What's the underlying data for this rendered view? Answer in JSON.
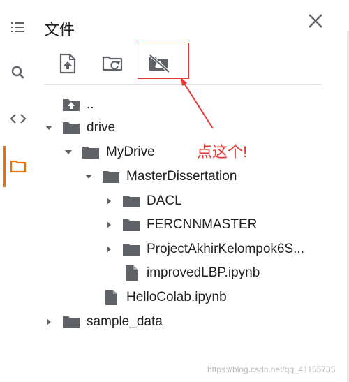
{
  "sidebar": {
    "items": [
      {
        "name": "table-of-contents-icon"
      },
      {
        "name": "search-icon"
      },
      {
        "name": "code-snippets-icon"
      },
      {
        "name": "files-folder-icon",
        "active": true
      }
    ],
    "accent_color": "#e8710a"
  },
  "panel": {
    "title": "文件",
    "close_icon": "close-icon",
    "toolbar": [
      {
        "name": "upload-file-button",
        "icon": "upload-file-icon"
      },
      {
        "name": "refresh-folder-button",
        "icon": "refresh-folder-icon"
      },
      {
        "name": "mount-drive-button",
        "icon": "drive-off-icon",
        "highlighted": true
      }
    ]
  },
  "tree": [
    {
      "label": "..",
      "icon": "folder-up-icon",
      "expand": "none",
      "depth": 0
    },
    {
      "label": "drive",
      "icon": "folder-icon",
      "expand": "expanded",
      "depth": 0
    },
    {
      "label": "MyDrive",
      "icon": "folder-icon",
      "expand": "expanded",
      "depth": 1
    },
    {
      "label": "MasterDissertation",
      "icon": "folder-icon",
      "expand": "expanded",
      "depth": 2
    },
    {
      "label": "DACL",
      "icon": "folder-icon",
      "expand": "collapsed",
      "depth": 3
    },
    {
      "label": "FERCNNMASTER",
      "icon": "folder-icon",
      "expand": "collapsed",
      "depth": 3
    },
    {
      "label": "ProjectAkhirKelompok6S...",
      "icon": "folder-icon",
      "expand": "collapsed",
      "depth": 3
    },
    {
      "label": "improvedLBP.ipynb",
      "icon": "file-icon",
      "expand": "none",
      "depth": 3
    },
    {
      "label": "HelloColab.ipynb",
      "icon": "file-icon",
      "expand": "none",
      "depth": 2
    },
    {
      "label": "sample_data",
      "icon": "folder-icon",
      "expand": "collapsed",
      "depth": 0
    }
  ],
  "annotation": {
    "text": "点这个!",
    "color": "#e53935"
  },
  "watermark": "https://blog.csdn.net/qq_41155735"
}
